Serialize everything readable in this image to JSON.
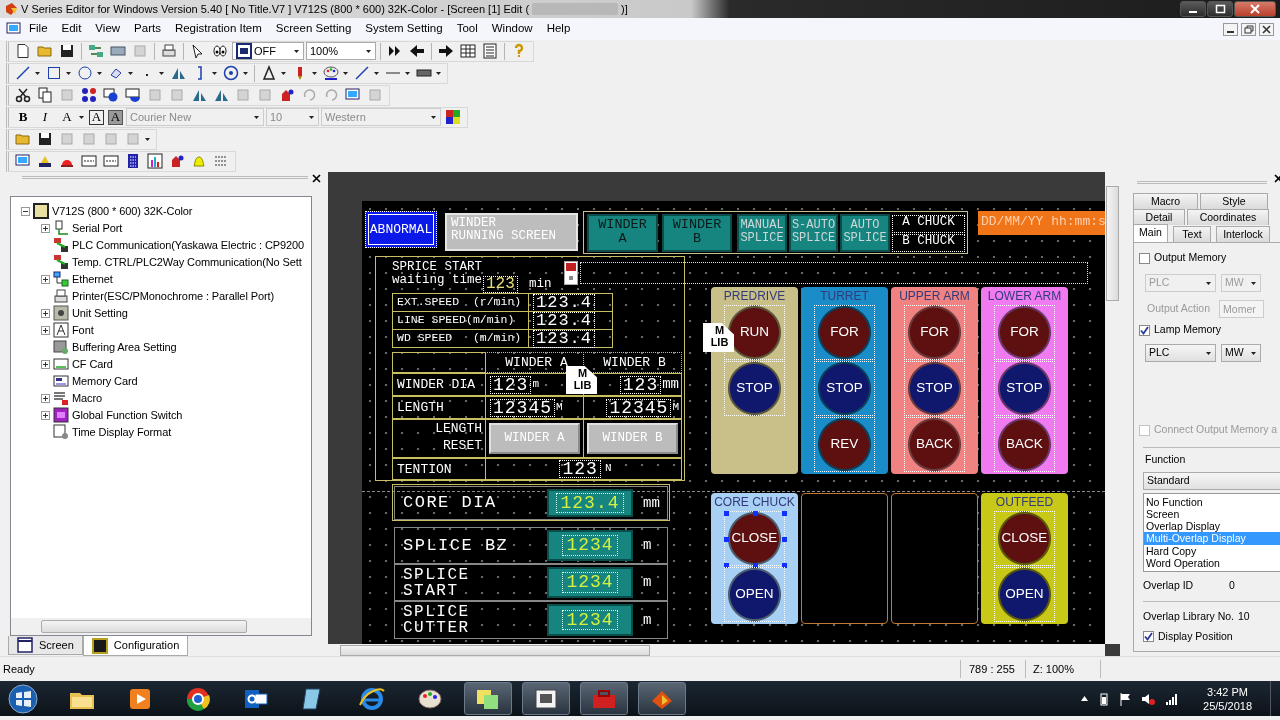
{
  "window": {
    "title": "V Series Editor for Windows Version 5.40 [ No Title.V7 ] V712S (800 * 600) 32K-Color - [Screen [1] Edit (",
    "title_end": ")]"
  },
  "menu": [
    "File",
    "Edit",
    "View",
    "Parts",
    "Registration Item",
    "Screen Setting",
    "System Setting",
    "Tool",
    "Window",
    "Help"
  ],
  "toolbar": {
    "overlap_mode": "OFF",
    "zoom": "100%",
    "font": "Courier New",
    "font_size": "10",
    "charset": "Western",
    "style_buttons": [
      {
        "label": "B",
        "kind": "bold"
      },
      {
        "label": "I",
        "kind": "italic"
      },
      {
        "label": "A",
        "kind": "color"
      },
      {
        "label": "A",
        "kind": "framed"
      },
      {
        "label": "A",
        "kind": "shaded"
      }
    ]
  },
  "tree": {
    "label": "V712S (800 * 600) 32K-Color",
    "expanded": true,
    "children": [
      {
        "label": "Serial Port",
        "expanded": false
      },
      {
        "label": "PLC Communication(Yaskawa Electric : CP9200"
      },
      {
        "label": "Temp. CTRL/PLC2Way Communication(No Sett"
      },
      {
        "label": "Ethernet",
        "expanded": false
      },
      {
        "label": "Printer(ESC/PMonochrome : Parallel Port)"
      },
      {
        "label": "Unit Setting",
        "expanded": false
      },
      {
        "label": "Font",
        "expanded": false
      },
      {
        "label": "Buffering Area Setting"
      },
      {
        "label": "CF Card",
        "expanded": false
      },
      {
        "label": "Memory Card"
      },
      {
        "label": "Macro",
        "expanded": false
      },
      {
        "label": "Global Function Switch",
        "expanded": false
      },
      {
        "label": "Time Display Format"
      }
    ]
  },
  "left_tabs": [
    {
      "label": "Screen",
      "selected": false
    },
    {
      "label": "Configuration",
      "selected": true
    }
  ],
  "hmi": {
    "alarm": "ABNORMAL",
    "screen_title": [
      "WINDER",
      "RUNNING SCREEN"
    ],
    "mode_buttons": [
      {
        "kind": "large",
        "lines": [
          "WINDER",
          "A"
        ]
      },
      {
        "kind": "large",
        "lines": [
          "WINDER",
          "B"
        ]
      },
      {
        "kind": "small",
        "lines": [
          "MANUAL",
          "SPLICE"
        ]
      },
      {
        "kind": "small",
        "lines": [
          "S-AUTO",
          "SPLICE"
        ]
      },
      {
        "kind": "small",
        "lines": [
          "AUTO",
          "SPLICE"
        ]
      }
    ],
    "chuck_labels": [
      "A CHUCK",
      "B CHUCK"
    ],
    "datetime": "DD/MM/YY hh:mm:s",
    "wait": {
      "lines": [
        "SPRICE START",
        "waiting time"
      ],
      "value": "123",
      "unit": "min"
    },
    "speeds": [
      {
        "label": "EXT.SPEED  (r/min)",
        "value": "123.4"
      },
      {
        "label": "LINE SPEED(m/min)",
        "value": "123.4"
      },
      {
        "label": "WD SPEED   (m/min)",
        "value": "123.4"
      }
    ],
    "winder_table": {
      "columns": [
        "WINDER A",
        "WINDER B"
      ],
      "rows": [
        {
          "kind": "values",
          "lines": [
            "WINDER DIA"
          ],
          "values": [
            {
              "value": "123",
              "unit": "m"
            },
            {
              "value": "123",
              "unit": "mm"
            }
          ]
        },
        {
          "kind": "values",
          "lines": [
            "LENGTH"
          ],
          "values": [
            {
              "value": "12345",
              "unit": "M"
            },
            {
              "value": "12345",
              "unit": "M"
            }
          ]
        },
        {
          "kind": "buttons",
          "lines": [
            "LENGTH",
            "RESET"
          ],
          "buttons": [
            "WINDER A",
            "WINDER B"
          ]
        },
        {
          "kind": "single",
          "lines": [
            "TENTION"
          ],
          "value": "123",
          "unit": "N"
        }
      ]
    },
    "setpoints": [
      {
        "lines": [
          "CORE DIA"
        ],
        "value": "123.4",
        "unit": "mm"
      },
      {
        "lines": [
          "SPLICE BZ"
        ],
        "value": "1234",
        "unit": "m"
      },
      {
        "lines": [
          "SPLICE",
          "START"
        ],
        "value": "1234",
        "unit": "m"
      },
      {
        "lines": [
          "SPLICE",
          "CUTTER"
        ],
        "value": "1234",
        "unit": "m"
      }
    ],
    "library_marks": [
      {
        "lines": [
          "M",
          "LIB"
        ]
      },
      {
        "lines": [
          "M",
          "LIB"
        ]
      }
    ],
    "lamp_groups": [
      {
        "kind": "panel",
        "title": "PREDRIVE",
        "color": "#c8c088",
        "lamps": [
          {
            "label": "RUN",
            "color": "#5e1010",
            "selected": false
          },
          {
            "label": "STOP",
            "color": "#10186e",
            "selected": false
          }
        ]
      },
      {
        "kind": "panel",
        "title": "TURRET",
        "color": "#1a8cc8",
        "lamps": [
          {
            "label": "FOR",
            "color": "#5e1010",
            "selected": false
          },
          {
            "label": "STOP",
            "color": "#10186e",
            "selected": false
          },
          {
            "label": "REV",
            "color": "#5e1010",
            "selected": false
          }
        ]
      },
      {
        "kind": "panel",
        "title": "UPPER ARM",
        "color": "#f08282",
        "lamps": [
          {
            "label": "FOR",
            "color": "#5e1010",
            "selected": false
          },
          {
            "label": "STOP",
            "color": "#10186e",
            "selected": false
          },
          {
            "label": "BACK",
            "color": "#5e1010",
            "selected": false
          }
        ]
      },
      {
        "kind": "panel",
        "title": "LOWER ARM",
        "color": "#f07af0",
        "lamps": [
          {
            "label": "FOR",
            "color": "#5e1010",
            "selected": false
          },
          {
            "label": "STOP",
            "color": "#10186e",
            "selected": false
          },
          {
            "label": "BACK",
            "color": "#5e1010",
            "selected": false
          }
        ]
      },
      {
        "kind": "panel",
        "title": "CORE CHUCK",
        "color": "#a8d0f4",
        "lamps": [
          {
            "label": "CLOSE",
            "color": "#5e1010",
            "selected": true
          },
          {
            "label": "OPEN",
            "color": "#10186e",
            "selected": false
          }
        ]
      },
      {
        "kind": "empty"
      },
      {
        "kind": "empty"
      },
      {
        "kind": "panel",
        "title": "OUTFEED",
        "color": "#c8c818",
        "lamps": [
          {
            "label": "CLOSE",
            "color": "#5e1010",
            "selected": false
          },
          {
            "label": "OPEN",
            "color": "#10186e",
            "selected": false
          }
        ]
      }
    ]
  },
  "properties": {
    "tab_rows": [
      [
        {
          "label": "Macro",
          "selected": false
        },
        {
          "label": "Style",
          "selected": false
        }
      ],
      [
        {
          "label": "Detail",
          "selected": false
        },
        {
          "label": "Coordinates",
          "selected": false
        }
      ],
      [
        {
          "label": "Main",
          "selected": true
        },
        {
          "label": "Text",
          "selected": false
        },
        {
          "label": "Interlock",
          "selected": false
        }
      ]
    ],
    "output_memory": {
      "label": "Output Memory",
      "checked": false,
      "device": "PLC",
      "memory": "MW",
      "disabled": true
    },
    "output_action": {
      "label": "Output Action",
      "value": "Momer",
      "disabled": true
    },
    "lamp_memory": {
      "label": "Lamp Memory",
      "checked": true,
      "device": "PLC",
      "memory": "MW",
      "disabled": false
    },
    "connect": {
      "label": "Connect Output Memory a",
      "checked": false,
      "disabled": true
    },
    "function": {
      "label": "Function",
      "value": "Standard",
      "options": [
        {
          "label": "No Function",
          "selected": false
        },
        {
          "label": "Screen",
          "selected": false
        },
        {
          "label": "Overlap Display",
          "selected": false
        },
        {
          "label": "Multi-Overlap Display",
          "selected": true
        },
        {
          "label": "Hard Copy",
          "selected": false
        },
        {
          "label": "Word Operation",
          "selected": false
        }
      ]
    },
    "overlap_id": {
      "label": "Overlap ID",
      "value": "0"
    },
    "overlap_library": {
      "label": "Overlap Library No.",
      "value": "10"
    },
    "display_position": {
      "label": "Display Position",
      "checked": true
    }
  },
  "status_bar": {
    "message": "Ready",
    "cursor": "789 : 255",
    "zoom": "Z: 100%"
  },
  "taskbar": {
    "apps": [
      {
        "running": false
      },
      {
        "running": false
      },
      {
        "running": false
      },
      {
        "running": false
      },
      {
        "running": false
      },
      {
        "running": false
      },
      {
        "running": false
      },
      {
        "running": true
      },
      {
        "running": true
      },
      {
        "running": true
      },
      {
        "running": true
      }
    ],
    "time": "3:42 PM",
    "date": "25/5/2018"
  }
}
